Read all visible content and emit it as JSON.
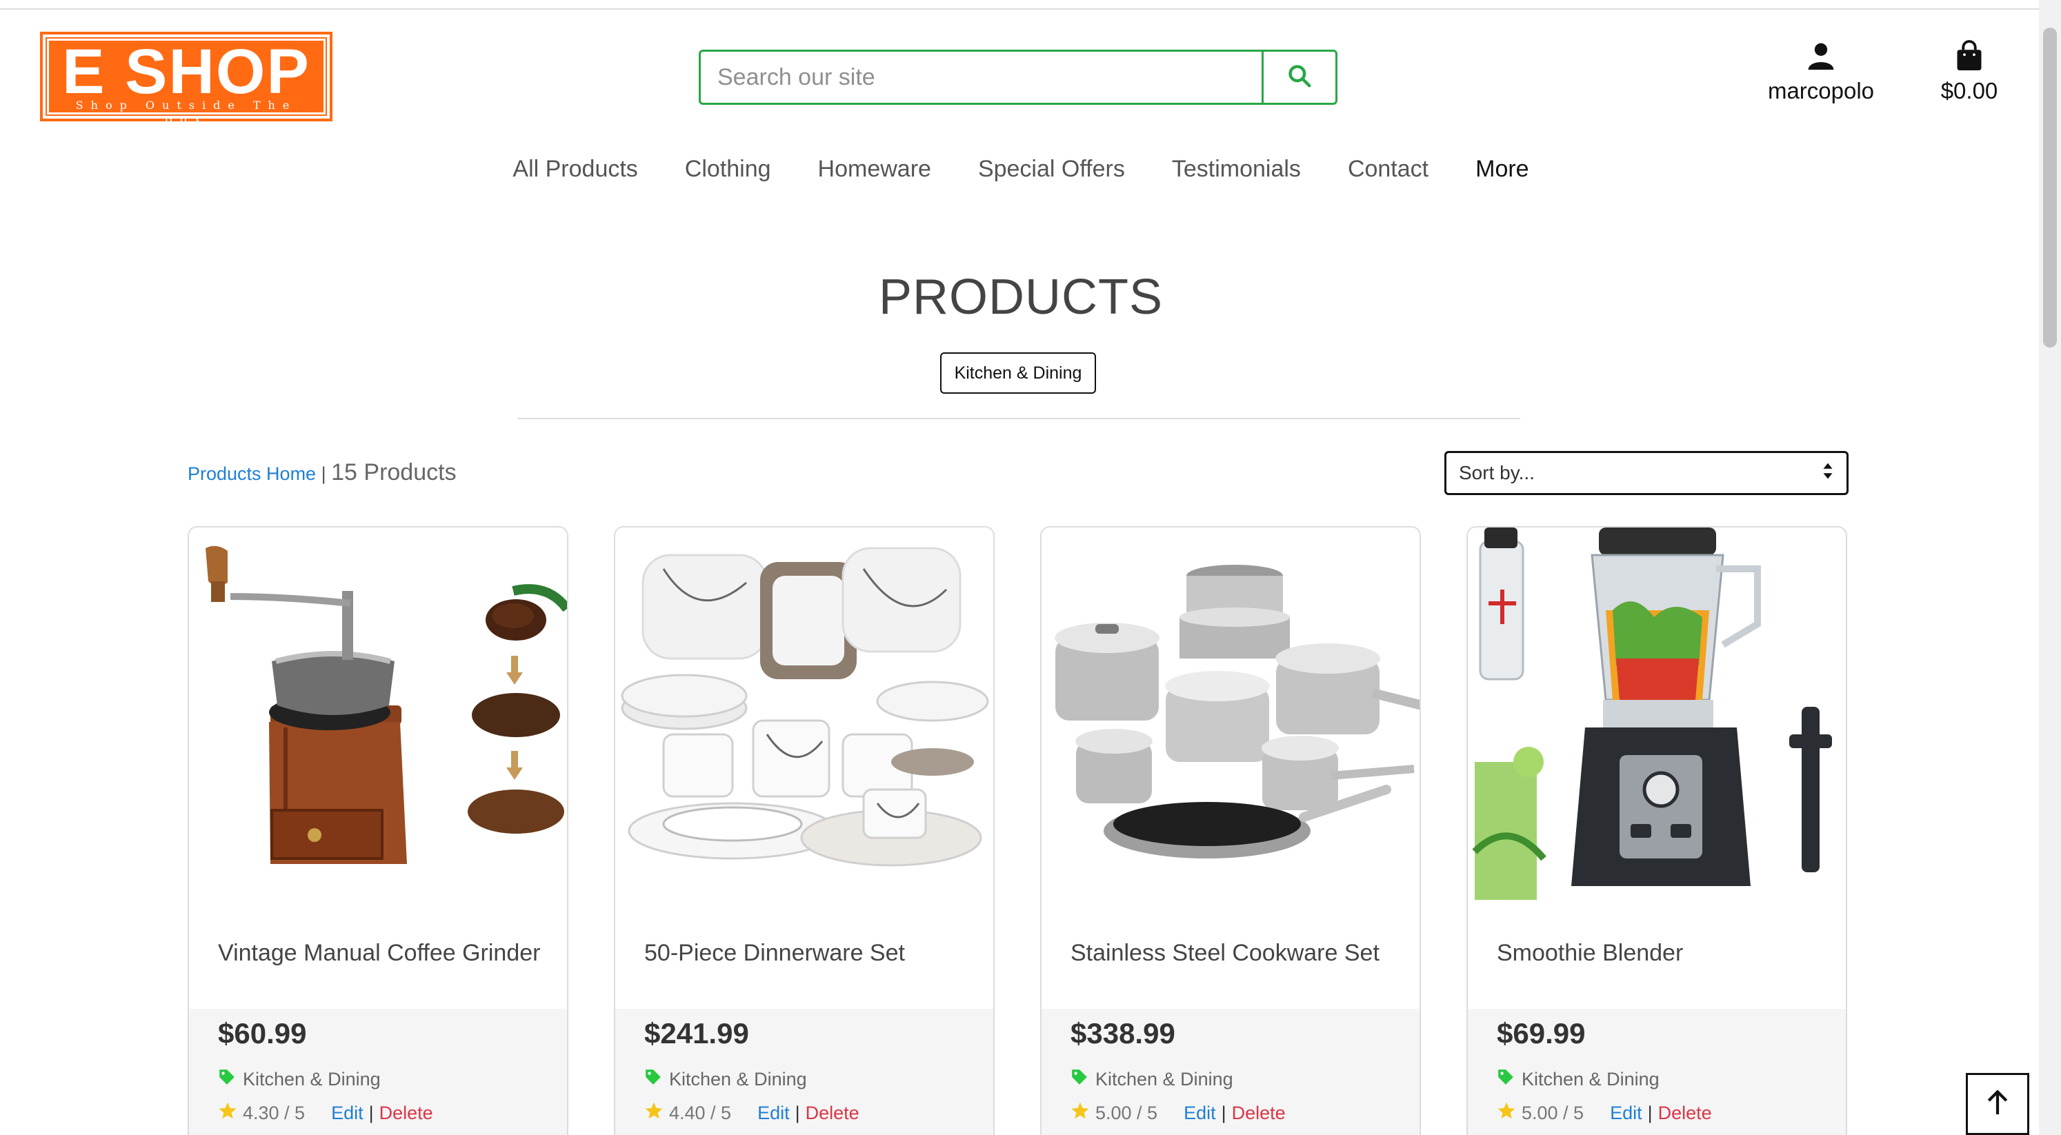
{
  "logo": {
    "title": "E SHOP",
    "tagline": "Shop Outside The Box"
  },
  "search": {
    "placeholder": "Search our site"
  },
  "account": {
    "username": "marcopolo"
  },
  "bag": {
    "total": "$0.00"
  },
  "nav": {
    "items": [
      "All Products",
      "Clothing",
      "Homeware",
      "Special Offers",
      "Testimonials",
      "Contact",
      "More"
    ]
  },
  "page": {
    "title": "PRODUCTS",
    "category_badge": "Kitchen & Dining"
  },
  "toolbar": {
    "breadcrumb_link": "Products Home",
    "separator": "|",
    "product_count": "15 Products",
    "sort_label": "Sort by..."
  },
  "products": [
    {
      "name": "Vintage Manual Coffee Grinder",
      "price": "$60.99",
      "category": "Kitchen & Dining",
      "rating": "4.30 / 5",
      "edit": "Edit",
      "sep": "|",
      "delete": "Delete"
    },
    {
      "name": "50-Piece Dinnerware Set",
      "price": "$241.99",
      "category": "Kitchen & Dining",
      "rating": "4.40 / 5",
      "edit": "Edit",
      "sep": "|",
      "delete": "Delete"
    },
    {
      "name": "Stainless Steel Cookware Set",
      "price": "$338.99",
      "category": "Kitchen & Dining",
      "rating": "5.00 / 5",
      "edit": "Edit",
      "sep": "|",
      "delete": "Delete"
    },
    {
      "name": "Smoothie Blender",
      "price": "$69.99",
      "category": "Kitchen & Dining",
      "rating": "5.00 / 5",
      "edit": "Edit",
      "sep": "|",
      "delete": "Delete"
    }
  ],
  "colors": {
    "brand": "#ff6a13",
    "search_border": "#28a745",
    "link": "#1e7fd6",
    "delete": "#dc3545",
    "tag_icon": "#28c940",
    "star": "#f5c518"
  },
  "icons": {
    "search": "search-icon",
    "account": "user-icon",
    "bag": "shopping-bag-icon",
    "tag": "tag-icon",
    "star": "star-icon",
    "sort": "sort-arrows-icon",
    "to_top": "arrow-up-icon"
  }
}
